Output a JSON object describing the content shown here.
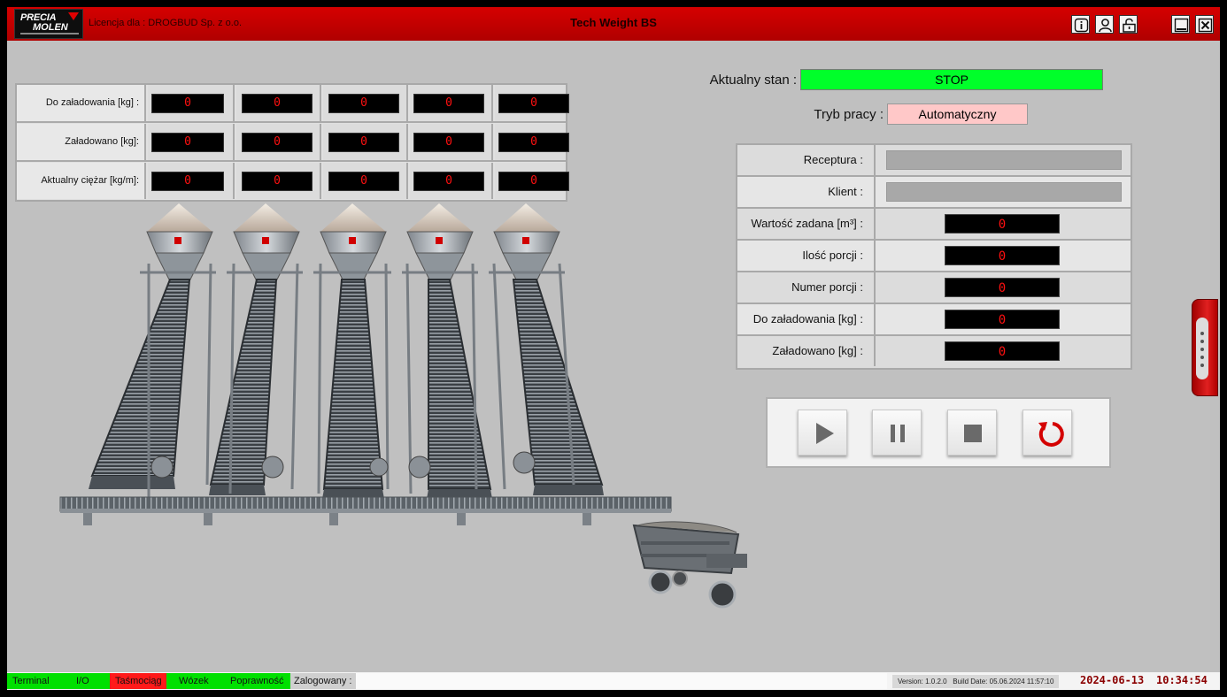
{
  "titlebar": {
    "logo_line1": "PRECIA",
    "logo_line2": "MOLEN",
    "license": "Licencja dla : DROGBUD Sp. z o.o.",
    "app_title": "Tech Weight BS",
    "buttons": [
      "info-icon",
      "user-icon",
      "lock-icon",
      "minimize-icon",
      "close-icon"
    ]
  },
  "loading_table": {
    "rows": [
      {
        "label": "Do załadowania [kg] :",
        "values": [
          "0",
          "0",
          "0",
          "0",
          "0"
        ]
      },
      {
        "label": "Załadowano  [kg]:",
        "values": [
          "0",
          "0",
          "0",
          "0",
          "0"
        ]
      },
      {
        "label": "Aktualny ciężar [kg/m]:",
        "values": [
          "0",
          "0",
          "0",
          "0",
          "0"
        ]
      }
    ]
  },
  "state": {
    "label": "Aktualny stan :",
    "value": "STOP",
    "color": "#00ff2a"
  },
  "mode": {
    "label": "Tryb pracy :",
    "value": "Automatyczny",
    "color": "#ffc8c8"
  },
  "recipe_table": {
    "rows": [
      {
        "label": "Receptura :",
        "value": ""
      },
      {
        "label": "Klient :",
        "value": ""
      },
      {
        "label": "Wartość zadana [m³] :",
        "value": "0"
      },
      {
        "label": "Ilość porcji :",
        "value": "0"
      },
      {
        "label": "Numer porcji :",
        "value": "0"
      },
      {
        "label": "Do załadowania  [kg] :",
        "value": "0"
      },
      {
        "label": "Załadowano [kg] :",
        "value": "0"
      }
    ]
  },
  "controls": [
    "play-icon",
    "pause-icon",
    "stop-icon",
    "reset-icon"
  ],
  "statusbar": {
    "items": [
      {
        "label": "Terminal",
        "color": "#00e000"
      },
      {
        "label": "I/O",
        "color": "#00e000"
      },
      {
        "label": "Taśmociąg",
        "color": "#ff1a1a"
      },
      {
        "label": "Wózek",
        "color": "#00e000"
      },
      {
        "label": "Poprawność",
        "color": "#00e000"
      }
    ],
    "logged_label": "Zalogowany :",
    "logged_value": "",
    "version": "Version: 1.0.2.0",
    "build_date": "Build Date: 05.06.2024 11:57:10",
    "date": "2024-06-13",
    "time": "10:34:54"
  }
}
